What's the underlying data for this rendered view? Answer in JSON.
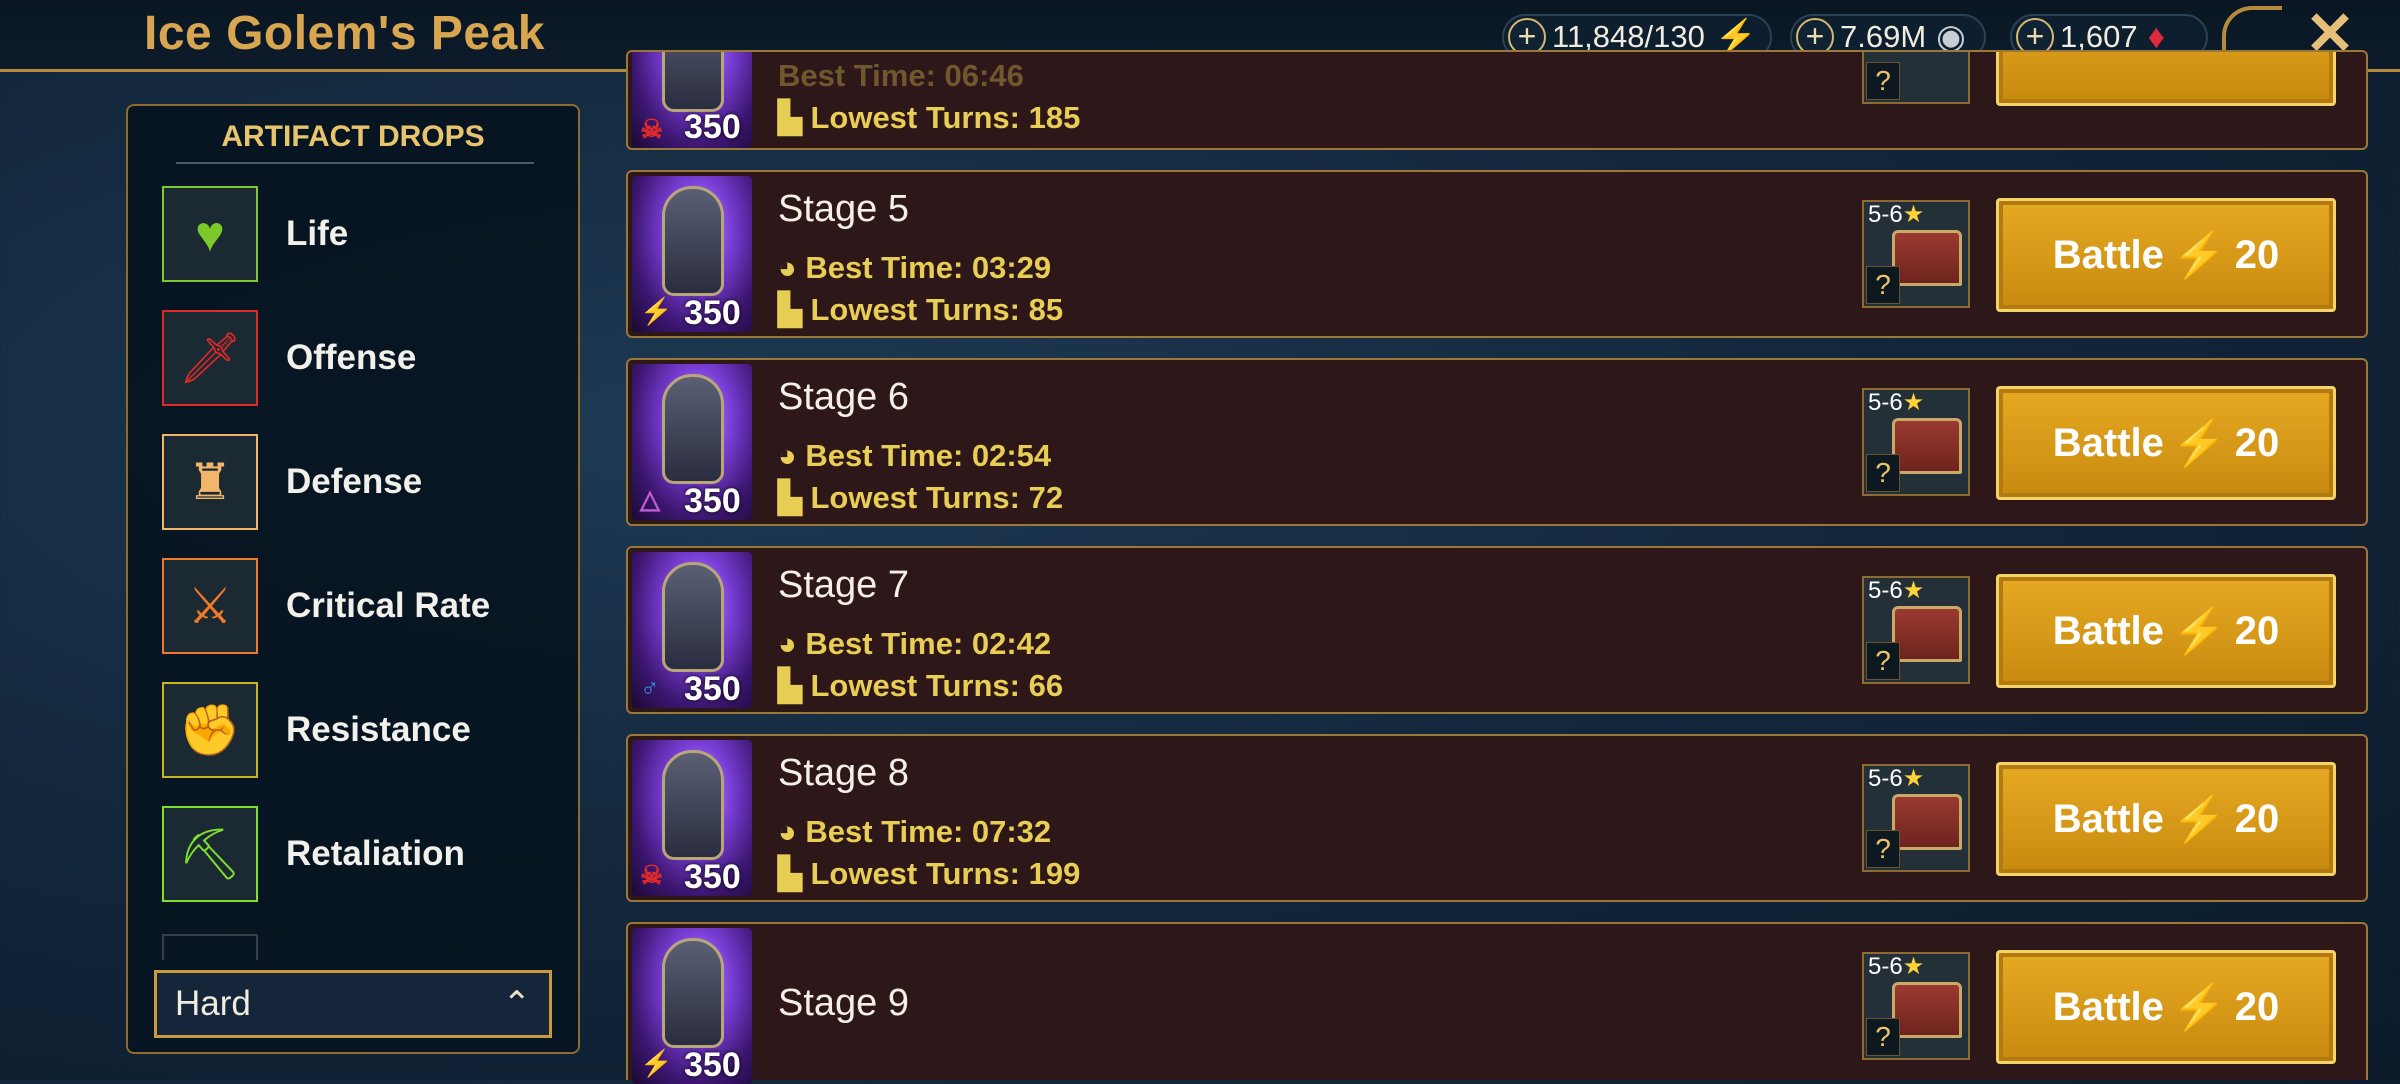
{
  "title": "Ice Golem's Peak",
  "resources": {
    "energy": {
      "value": "11,848/130",
      "icon": "energy-bolt-icon"
    },
    "silver": {
      "value": "7.69M",
      "icon": "silver-coin-icon"
    },
    "gems": {
      "value": "1,607",
      "icon": "gem-icon"
    }
  },
  "close_label": "✕",
  "drops": {
    "title": "ARTIFACT DROPS",
    "items": [
      {
        "label": "Life",
        "icon": "♥",
        "color": "#7bc92a"
      },
      {
        "label": "Offense",
        "icon": "🗡",
        "color": "#e02a2a"
      },
      {
        "label": "Defense",
        "icon": "♜",
        "color": "#f2b56a"
      },
      {
        "label": "Critical Rate",
        "icon": "⚔",
        "color": "#f07a28"
      },
      {
        "label": "Resistance",
        "icon": "✊",
        "color": "#c9b51e"
      },
      {
        "label": "Retaliation",
        "icon": "⛏",
        "color": "#7ee02a"
      }
    ]
  },
  "difficulty": {
    "value": "Hard",
    "chevron": "⌃"
  },
  "partial_stage": {
    "best_time": "Best Time: 06:46",
    "lowest_turns": "Lowest Turns: 185",
    "power": "350"
  },
  "stages": [
    {
      "name": "Stage 5",
      "power": "350",
      "affinity": "⚡",
      "affinity_color": "#4bd23a",
      "best_time": "Best Time: 03:29",
      "lowest_turns": "Lowest Turns: 85"
    },
    {
      "name": "Stage 6",
      "power": "350",
      "affinity": "△",
      "affinity_color": "#c05ad8",
      "best_time": "Best Time: 02:54",
      "lowest_turns": "Lowest Turns: 72"
    },
    {
      "name": "Stage 7",
      "power": "350",
      "affinity": "♂",
      "affinity_color": "#3a8ce0",
      "best_time": "Best Time: 02:42",
      "lowest_turns": "Lowest Turns: 66"
    },
    {
      "name": "Stage 8",
      "power": "350",
      "affinity": "☠",
      "affinity_color": "#e02a2a",
      "best_time": "Best Time: 07:32",
      "lowest_turns": "Lowest Turns: 199"
    },
    {
      "name": "Stage 9",
      "power": "350",
      "affinity": "⚡",
      "affinity_color": "#4bd23a",
      "best_time": "",
      "lowest_turns": ""
    }
  ],
  "reward": {
    "rarity": "5-6",
    "star": "★",
    "unknown": "?"
  },
  "battle": {
    "label": "Battle",
    "cost": "20",
    "bolt": "⚡"
  }
}
